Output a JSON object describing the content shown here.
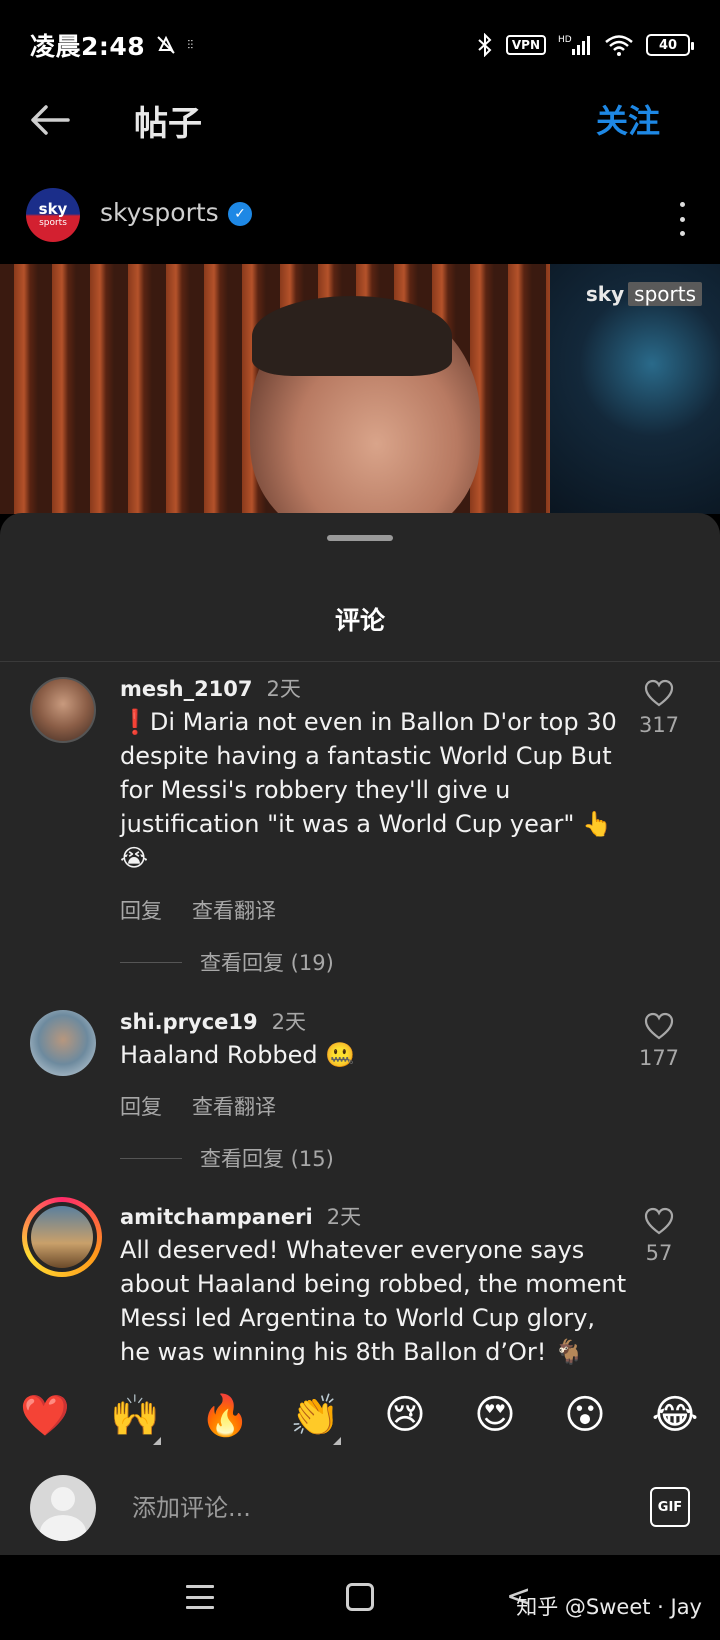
{
  "status_bar": {
    "time": "凌晨2:48",
    "vpn": "VPN",
    "hd": "HD",
    "battery": "40"
  },
  "header": {
    "title": "帖子",
    "follow_label": "关注"
  },
  "account": {
    "avatar_line1": "sky",
    "avatar_line2": "sports",
    "name": "skysports"
  },
  "post_image": {
    "badge_sky": "sky",
    "badge_sports": "sports"
  },
  "comments_sheet": {
    "title": "评论",
    "comments": [
      {
        "user": "mesh_2107",
        "time": "2天",
        "text": "❗Di Maria not even in Ballon D'or top 30 despite having a fantastic World Cup But for Messi's robbery they'll give u justification \"it was a World Cup year\" 👆😭",
        "reply_label": "回复",
        "translate_label": "查看翻译",
        "replies_label": "查看回复 (19)",
        "likes": "317"
      },
      {
        "user": "shi.pryce19",
        "time": "2天",
        "text": "Haaland Robbed 🤐",
        "reply_label": "回复",
        "translate_label": "查看翻译",
        "replies_label": "查看回复 (15)",
        "likes": "177"
      },
      {
        "user": "amitchampaneri",
        "time": "2天",
        "text": "All deserved! Whatever everyone says about Haaland being robbed, the moment Messi led Argentina to World Cup glory, he was winning his 8th Ballon d’Or! 🐐",
        "likes": "57"
      }
    ]
  },
  "emoji_bar": [
    "❤️",
    "🙌",
    "🔥",
    "👏",
    "😢",
    "😍",
    "😮",
    "😂"
  ],
  "input_bar": {
    "placeholder": "添加评论...",
    "gif_label": "GIF"
  },
  "nav_bar": {
    "back_glyph": "<",
    "watermark": "知乎 @Sweet · Jay"
  },
  "colors": {
    "accent": "#1e88e5",
    "sheet_bg": "#262626",
    "background": "#000000"
  }
}
